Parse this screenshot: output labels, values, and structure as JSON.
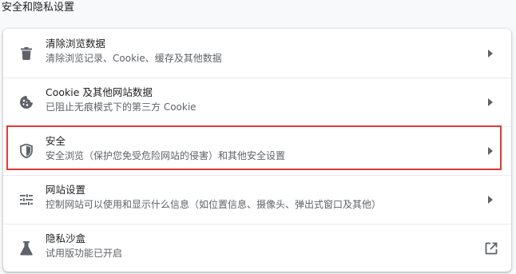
{
  "section_title": "安全和隐私设置",
  "rows": [
    {
      "icon": "trash-icon",
      "title": "清除浏览数据",
      "subtitle": "清除浏览记录、Cookie、缓存及其他数据",
      "action": "chevron-right-icon"
    },
    {
      "icon": "cookie-icon",
      "title": "Cookie 及其他网站数据",
      "subtitle": "已阻止无痕模式下的第三方 Cookie",
      "action": "chevron-right-icon"
    },
    {
      "icon": "shield-icon",
      "title": "安全",
      "subtitle": "安全浏览（保护您免受危险网站的侵害）和其他安全设置",
      "action": "chevron-right-icon"
    },
    {
      "icon": "sliders-icon",
      "title": "网站设置",
      "subtitle": "控制网站可以使用和显示什么信息（如位置信息、摄像头、弹出式窗口及其他）",
      "action": "chevron-right-icon"
    },
    {
      "icon": "flask-icon",
      "title": "隐私沙盒",
      "subtitle": "试用版功能已开启",
      "action": "external-link-icon"
    }
  ],
  "colors": {
    "highlight": "#e53935",
    "icon": "#5f6368",
    "text": "#202124",
    "subtext": "#5f6368"
  }
}
